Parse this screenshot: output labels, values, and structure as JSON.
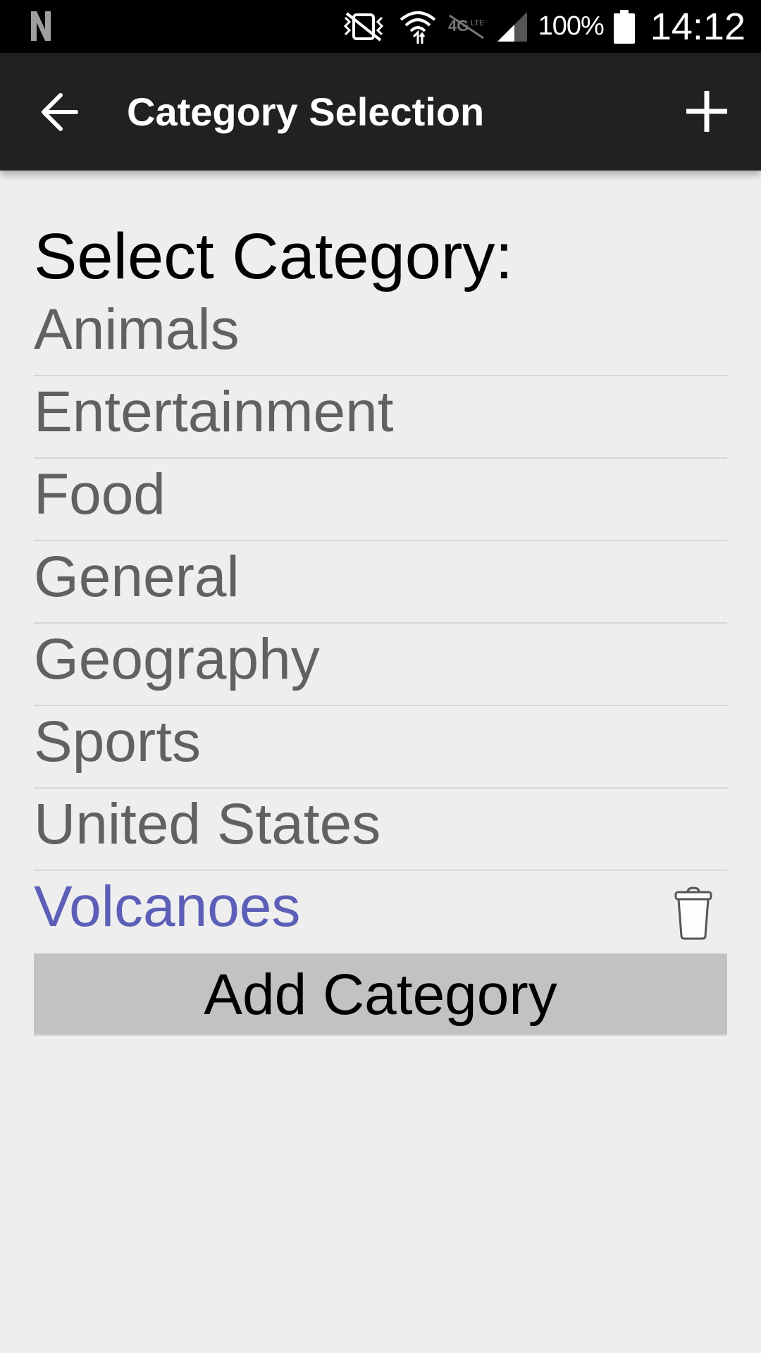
{
  "status_bar": {
    "left_icon": "n-notification-icon",
    "battery_percent": "100%",
    "time": "14:12",
    "icons": [
      "vibrate-mute-icon",
      "wifi-icon",
      "4g-lte-icon",
      "signal-icon",
      "battery-icon"
    ]
  },
  "app_bar": {
    "title": "Category Selection",
    "back_icon": "arrow-left-icon",
    "add_icon": "plus-icon"
  },
  "main": {
    "heading": "Select Category:",
    "categories": [
      {
        "label": "Animals",
        "selected": false
      },
      {
        "label": "Entertainment",
        "selected": false
      },
      {
        "label": "Food",
        "selected": false
      },
      {
        "label": "General",
        "selected": false
      },
      {
        "label": "Geography",
        "selected": false
      },
      {
        "label": "Sports",
        "selected": false
      },
      {
        "label": "United States",
        "selected": false
      },
      {
        "label": "Volcanoes",
        "selected": true,
        "delete_icon": "trash-icon"
      }
    ],
    "add_button_label": "Add Category"
  },
  "colors": {
    "status_bar_bg": "#000000",
    "app_bar_bg": "#212121",
    "page_bg": "#eeeeee",
    "item_text": "#616161",
    "selected_text": "#5c5fb8",
    "divider": "#d6d6d6",
    "button_bg": "#c2c2c2"
  }
}
